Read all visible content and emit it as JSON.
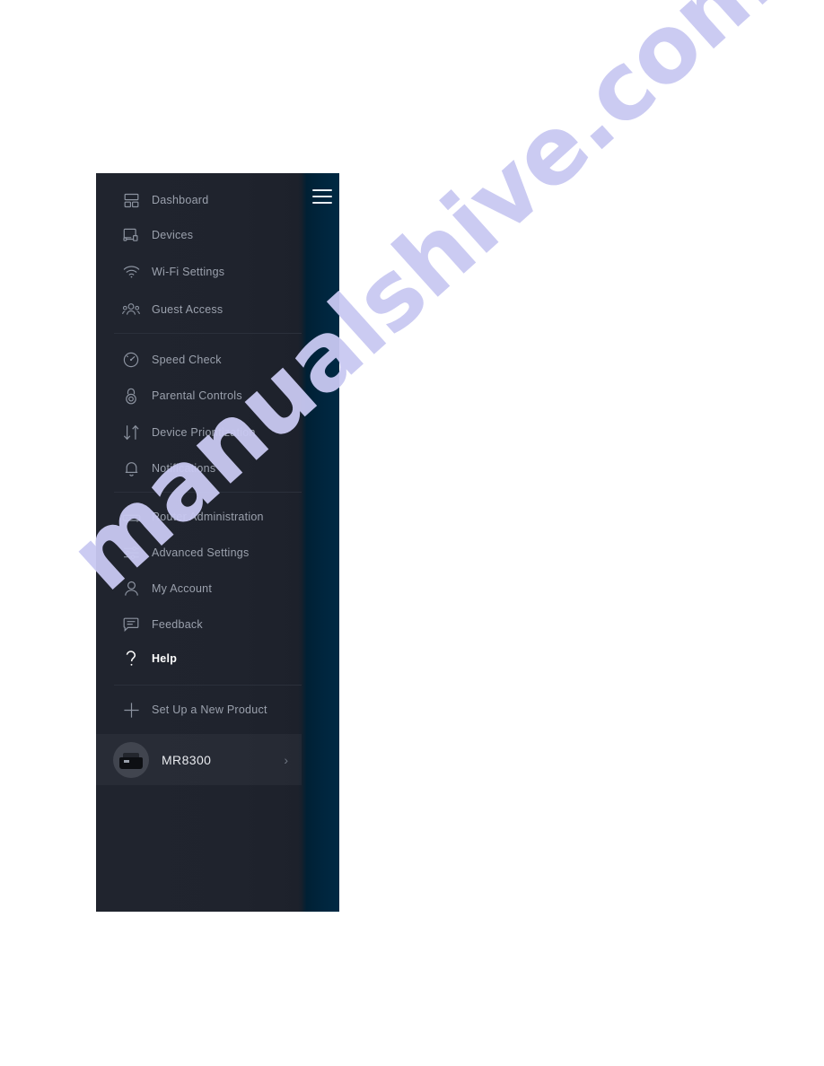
{
  "panel": {
    "hamburger_label": "menu-toggle",
    "groups": [
      {
        "items": [
          {
            "label": "Dashboard",
            "icon": "dashboard-icon"
          },
          {
            "label": "Devices",
            "icon": "devices-icon"
          },
          {
            "label": "Wi-Fi Settings",
            "icon": "wifi-icon"
          },
          {
            "label": "Guest Access",
            "icon": "guest-access-icon"
          }
        ]
      },
      {
        "items": [
          {
            "label": "Speed Check",
            "icon": "speedometer-icon"
          },
          {
            "label": "Parental Controls",
            "icon": "lock-icon"
          },
          {
            "label": "Device Prioritization",
            "icon": "up-down-arrows-icon"
          },
          {
            "label": "Notifications",
            "icon": "bell-icon"
          }
        ]
      },
      {
        "items": [
          {
            "label": "Router Administration",
            "icon": "router-icon"
          },
          {
            "label": "Advanced Settings",
            "icon": "sliders-icon"
          },
          {
            "label": "My Account",
            "icon": "person-icon"
          },
          {
            "label": "Feedback",
            "icon": "chat-bubble-icon"
          },
          {
            "label": "Help",
            "icon": "question-mark-icon",
            "active": true
          }
        ]
      },
      {
        "items": [
          {
            "label": "Set Up a New Product",
            "icon": "plus-icon"
          }
        ]
      }
    ],
    "device": {
      "name": "MR8300",
      "thumb_icon": "router-thumbnail",
      "chevron_icon": "chevron-right-icon"
    }
  },
  "watermark": {
    "text": "manualshive.com",
    "color": "#c9c9f2"
  },
  "theme": {
    "panel_left_bg": "#1f232d",
    "panel_right_bg": "#00253d",
    "label_color": "#9ba1ad",
    "active_color": "#ffffff",
    "page_bg": "#ffffff"
  }
}
